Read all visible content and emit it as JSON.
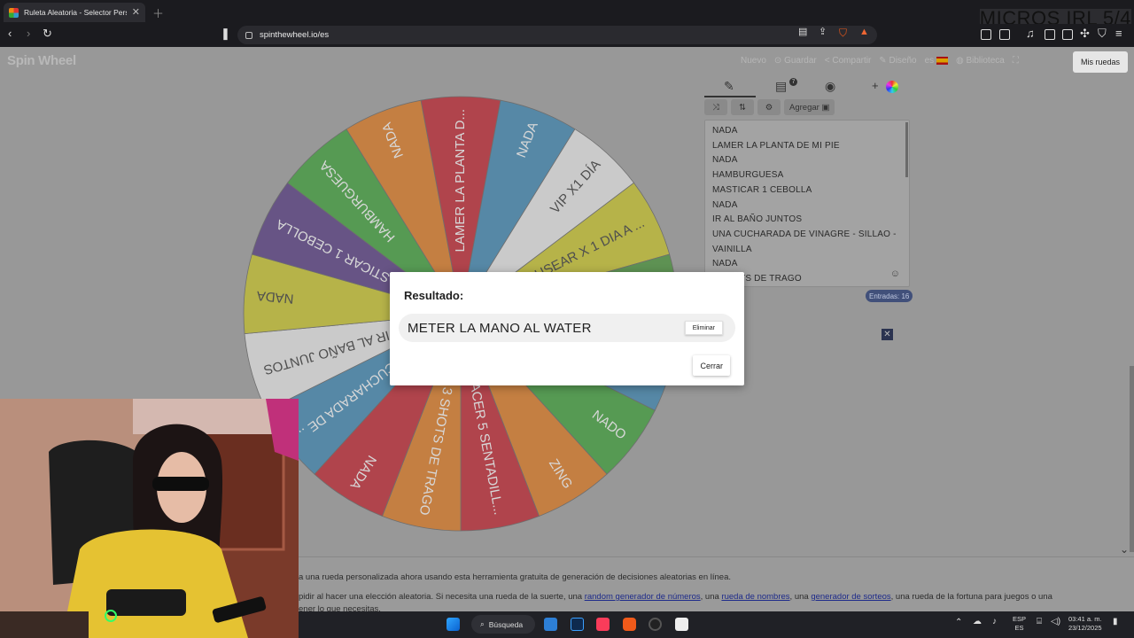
{
  "browser": {
    "tab_title": "Ruleta Aleatoria - Selector Perso",
    "url": "spinthewheel.io/es",
    "overlay_text": "MICROS IRL 5/4"
  },
  "site": {
    "logo": "Spin Wheel",
    "menu": {
      "nuevo": "Nuevo",
      "guardar": "Guardar",
      "compartir": "Compartir",
      "diseno": "Diseño",
      "lang": "es",
      "biblioteca": "Biblioteca",
      "mis_ruedas": "Mis ruedas"
    },
    "panel": {
      "badge": "7",
      "add_label": "+",
      "agregar": "Agregar",
      "entries": [
        "NADA",
        "LAMER LA PLANTA DE MI PIE",
        "NADA",
        "HAMBURGUESA",
        "MASTICAR 1 CEBOLLA",
        "NADA",
        "IR AL BAÑO JUNTOS",
        "UNA CUCHARADA DE VINAGRE - SILLAO -",
        "VAINILLA",
        "NADA",
        "3 SHOTS DE TRAGO"
      ],
      "count_label": "Entradas: 16"
    },
    "wheel": {
      "segments": [
        {
          "label": "LAMER LA PLANTA D...",
          "color": "#c0111f"
        },
        {
          "label": "NADA",
          "color": "#2f7fb0"
        },
        {
          "label": "VIP X1 DÍA",
          "color": "#eaeaea"
        },
        {
          "label": "USEAR X 1 DIA A ...",
          "color": "#c9c51a"
        },
        {
          "label": "",
          "color": "#3b8f2a"
        },
        {
          "label": "",
          "color": "#2f7fb0"
        },
        {
          "label": "NADO",
          "color": "#2e9c2a"
        },
        {
          "label": "ZING",
          "color": "#e0700e"
        },
        {
          "label": "HACER 5 SENTADILL...",
          "color": "#c0111f"
        },
        {
          "label": "3 SHOTS DE TRAGO",
          "color": "#e0700e"
        },
        {
          "label": "NADA",
          "color": "#c0111f"
        },
        {
          "label": "A CUCHARADA DE ...",
          "color": "#2f7fb0"
        },
        {
          "label": "IR AL BAÑO JUNTOS",
          "color": "#eaeaea"
        },
        {
          "label": "NADA",
          "color": "#c9c51a"
        },
        {
          "label": "MASTICAR 1 CEBOLLA",
          "color": "#4a2c7a"
        },
        {
          "label": "HAMBURGUESA",
          "color": "#2e9c2a"
        },
        {
          "label": "NADA",
          "color": "#e0700e"
        }
      ]
    },
    "footer": {
      "line1": "a una rueda personalizada ahora usando esta herramienta gratuita de generación de decisiones aleatorias en línea.",
      "line2_a": "pidir al hacer una elección aleatoria. Si necesita una rueda de la suerte, una ",
      "link1": "random generador de números",
      "line2_b": ", una ",
      "link2": "rueda de nombres",
      "line2_c": ", una ",
      "link3": "generador de sorteos",
      "line2_d": ", una rueda de la fortuna para juegos o una",
      "line3": "ener lo que necesitas."
    }
  },
  "modal": {
    "title": "Resultado:",
    "result": "METER LA MANO AL WATER",
    "eliminar": "Eliminar",
    "cerrar": "Cerrar"
  },
  "taskbar": {
    "search_label": "Búsqueda",
    "lang_top": "ESP",
    "lang_bottom": "ES",
    "time": "03:41 a. m.",
    "date": "23/12/2025"
  }
}
